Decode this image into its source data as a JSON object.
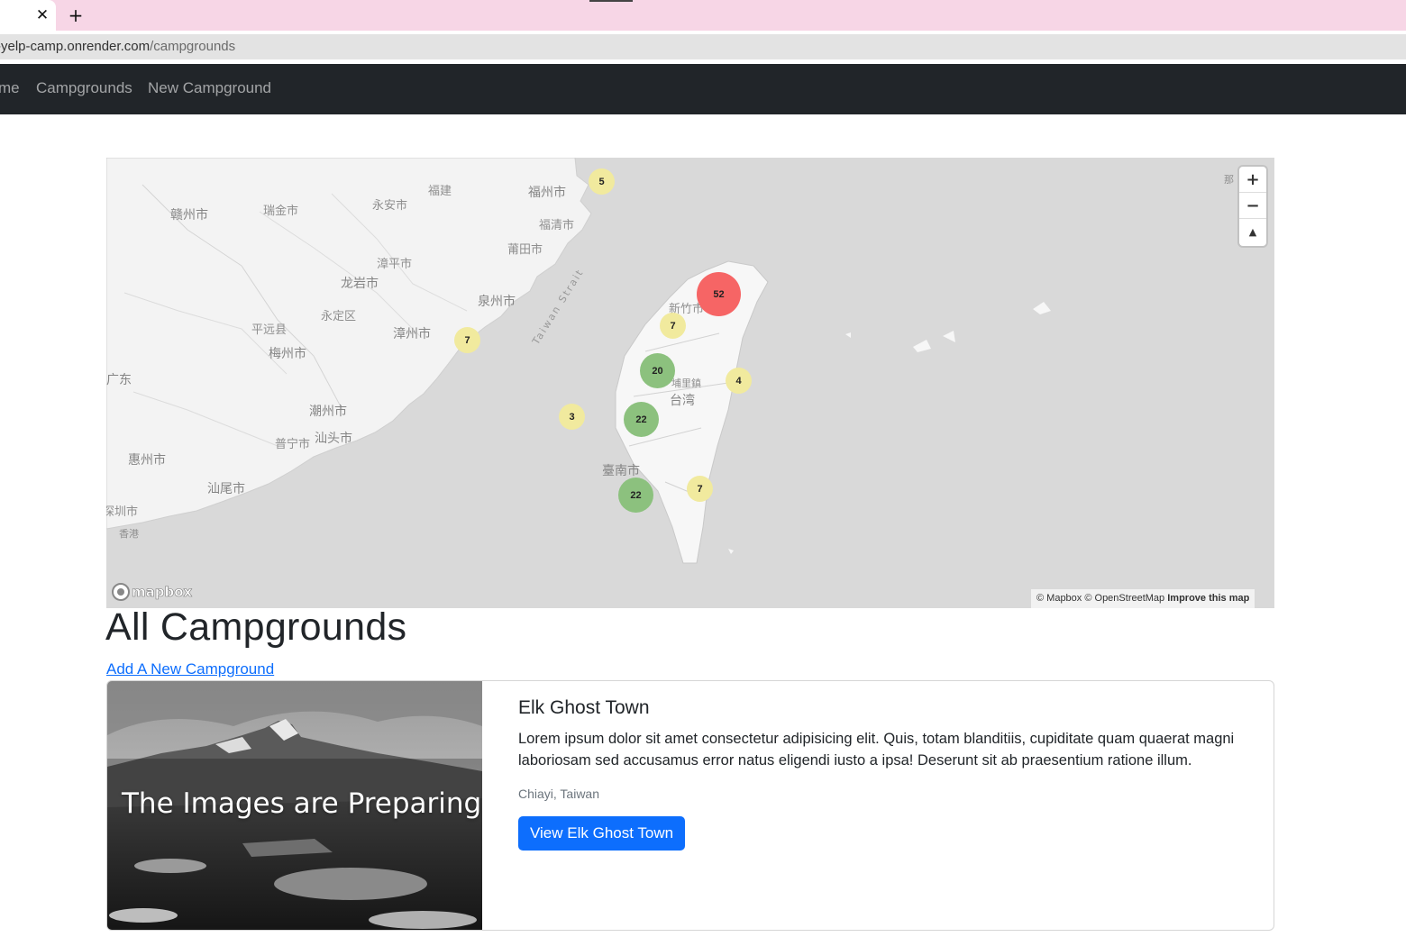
{
  "browser": {
    "tab_close_glyph": "✕",
    "new_tab_glyph": "+",
    "url_host": "-yelp-camp.onrender.com",
    "url_path": "/campgrounds"
  },
  "navbar": {
    "items": [
      {
        "label": "me"
      },
      {
        "label": "Campgrounds"
      },
      {
        "label": "New Campground"
      }
    ]
  },
  "map": {
    "labels": [
      "福建",
      "福州市",
      "永安市",
      "瑞金市",
      "赣州市",
      "福清市",
      "莆田市",
      "漳平市",
      "龙岩市",
      "泉州市",
      "永定区",
      "平远县",
      "梅州市",
      "漳州市",
      "Taiwan Strait",
      "新竹市",
      "埔里鎮",
      "台湾",
      "广东",
      "潮州市",
      "汕头市",
      "普宁市",
      "惠州市",
      "汕尾市",
      "深圳市",
      "香港",
      "臺南市",
      "那"
    ],
    "clusters": [
      "5",
      "52",
      "7",
      "7",
      "20",
      "4",
      "3",
      "22",
      "22",
      "7"
    ],
    "zoom_in": "+",
    "zoom_out": "−",
    "compass": "▲",
    "logo_text": "mapbox",
    "attribution": "© Mapbox © OpenStreetMap",
    "improve_link": "Improve this map",
    "colors": {
      "small_cluster": "#f1f075",
      "medium_cluster": "#51bbd6",
      "large_cluster": "#f28cb1"
    }
  },
  "page": {
    "title": "All Campgrounds",
    "add_link": "Add A New Campground"
  },
  "campgrounds": [
    {
      "image_caption": "The Images are Preparing",
      "title": "Elk Ghost Town",
      "description": "Lorem ipsum dolor sit amet consectetur adipisicing elit. Quis, totam blanditiis, cupiditate quam quaerat magni laboriosam sed accusamus error natus eligendi iusto a ipsa! Deserunt sit ab praesentium ratione illum.",
      "location": "Chiayi, Taiwan",
      "button": "View Elk Ghost Town"
    }
  ]
}
